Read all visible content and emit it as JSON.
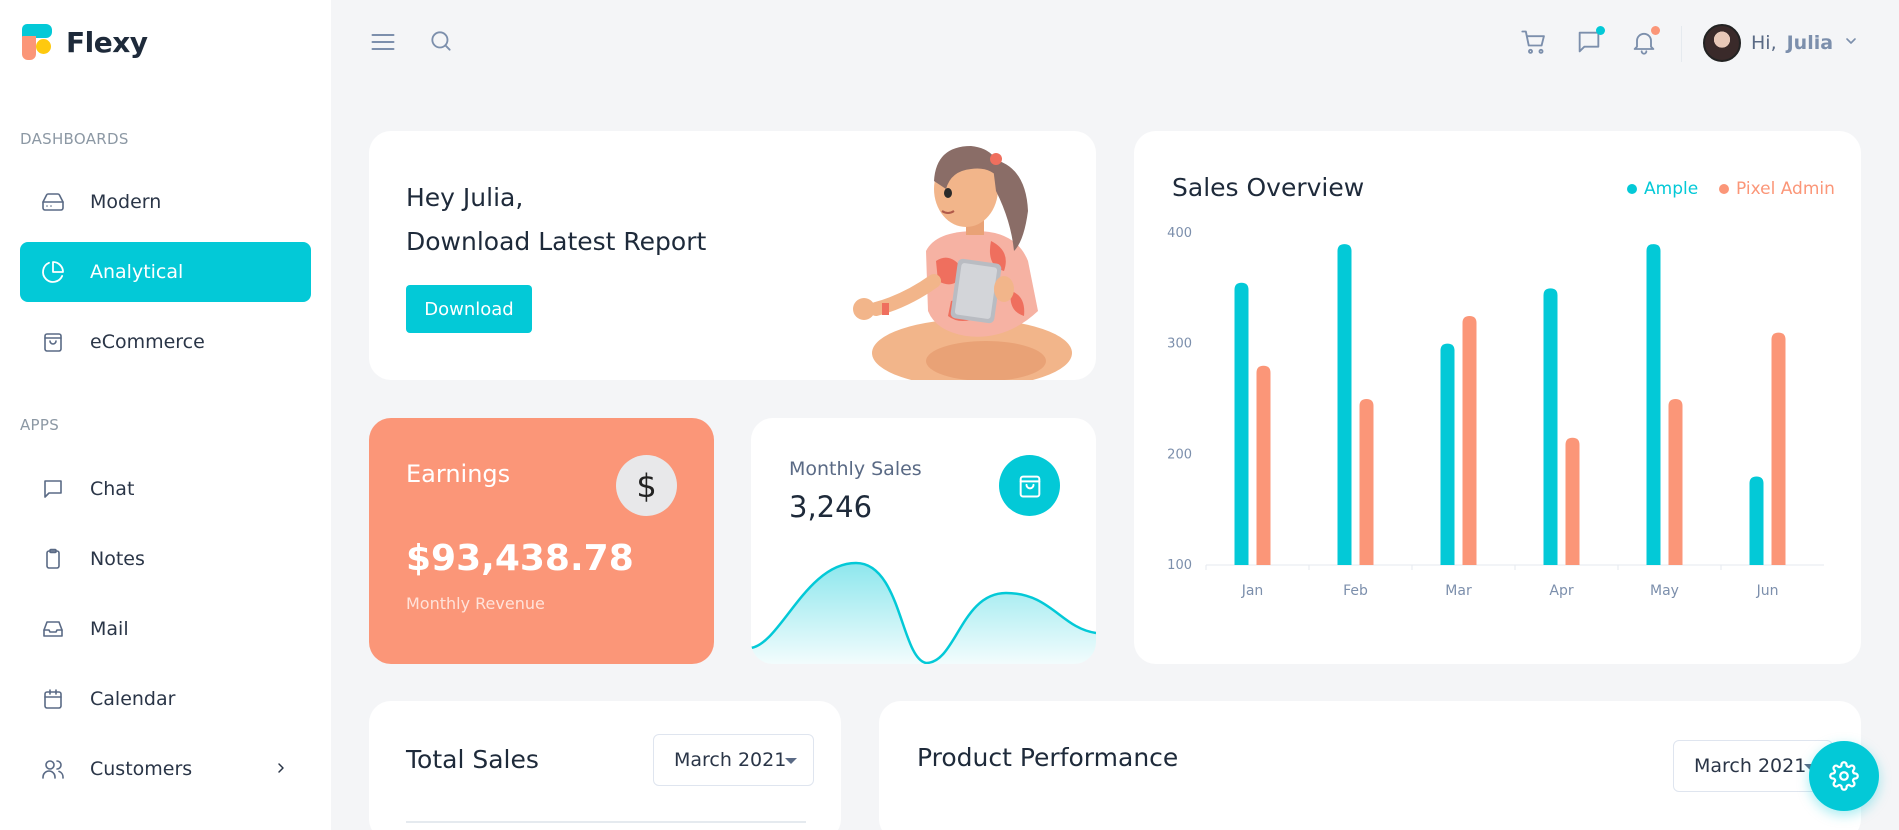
{
  "brand": {
    "name": "Flexy"
  },
  "sidebar": {
    "sections": [
      {
        "title": "DASHBOARDS"
      },
      {
        "title": "APPS"
      }
    ],
    "items": [
      {
        "label": "Modern",
        "icon": "dashboard-drive-icon",
        "active": false
      },
      {
        "label": "Analytical",
        "icon": "pie-chart-icon",
        "active": true
      },
      {
        "label": "eCommerce",
        "icon": "shopping-bag-icon",
        "active": false
      },
      {
        "label": "Chat",
        "icon": "chat-icon",
        "active": false
      },
      {
        "label": "Notes",
        "icon": "clipboard-icon",
        "active": false
      },
      {
        "label": "Mail",
        "icon": "inbox-icon",
        "active": false
      },
      {
        "label": "Calendar",
        "icon": "calendar-icon",
        "active": false
      },
      {
        "label": "Customers",
        "icon": "users-icon",
        "active": false,
        "expandable": true
      }
    ]
  },
  "topbar": {
    "greeting": "Hi,",
    "username": "Julia",
    "icons": [
      "menu-icon",
      "search-icon",
      "cart-icon",
      "message-icon",
      "bell-icon"
    ],
    "badge_colors": {
      "message": "#03c9d7",
      "bell": "#fb9678"
    }
  },
  "welcome": {
    "line1": "Hey Julia,",
    "line2": "Download Latest Report",
    "button": "Download"
  },
  "earnings": {
    "title": "Earnings",
    "value": "$93,438.78",
    "subtitle": "Monthly Revenue",
    "icon_symbol": "$"
  },
  "monthly_sales": {
    "title": "Monthly Sales",
    "value": "3,246"
  },
  "sales_overview": {
    "title": "Sales Overview",
    "legend": [
      {
        "name": "Ample",
        "color": "#03c9d7"
      },
      {
        "name": "Pixel Admin",
        "color": "#fb9678"
      }
    ]
  },
  "total_sales": {
    "title": "Total Sales",
    "select_value": "March 2021"
  },
  "product_performance": {
    "title": "Product Performance",
    "select_value": "March 2021"
  },
  "colors": {
    "accent": "#03c9d7",
    "secondary": "#fb9678"
  },
  "chart_data": {
    "type": "bar",
    "categories": [
      "Jan",
      "Feb",
      "Mar",
      "Apr",
      "May",
      "Jun"
    ],
    "series": [
      {
        "name": "Ample",
        "values": [
          355,
          390,
          300,
          350,
          390,
          180
        ]
      },
      {
        "name": "Pixel Admin",
        "values": [
          280,
          250,
          325,
          215,
          250,
          310
        ]
      }
    ],
    "yticks": [
      100,
      200,
      300,
      400
    ],
    "ylim": [
      100,
      400
    ],
    "grid": false,
    "legend": "top-right",
    "title": "Sales Overview"
  }
}
